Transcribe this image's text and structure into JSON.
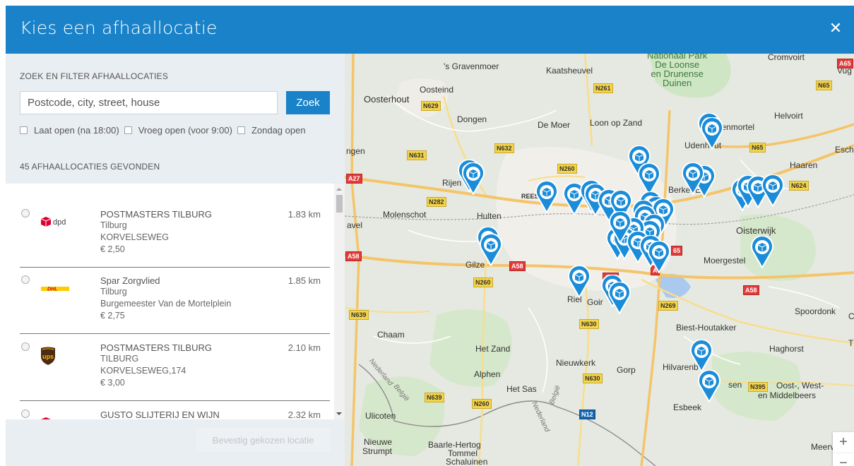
{
  "header": {
    "title": "Kies een afhaallocatie",
    "close_icon": "close-icon"
  },
  "filter": {
    "section_label": "ZOEK EN FILTER AFHAALLOCATIES",
    "search_placeholder": "Postcode, city, street, house",
    "search_button": "Zoek",
    "checkboxes": [
      "Laat open (na 18:00)",
      "Vroeg open (voor 9:00)",
      "Zondag open"
    ],
    "found_label": "45 AFHAALLOCATIES GEVONDEN"
  },
  "locations": [
    {
      "carrier": "dpd",
      "name": "POSTMASTERS TILBURG",
      "city": "Tilburg",
      "street": "KORVELSEWEG",
      "price": "€ 2,50",
      "distance": "1.83 km"
    },
    {
      "carrier": "dhl",
      "name": "Spar Zorgvlied",
      "city": "Tilburg",
      "street": "Burgemeester Van de Mortelplein",
      "price": "€ 2,75",
      "distance": "1.85 km"
    },
    {
      "carrier": "ups",
      "name": "POSTMASTERS TILBURG",
      "city": "TILBURG",
      "street": "KORVELSEWEG,174",
      "price": "€ 3,00",
      "distance": "2.10 km"
    },
    {
      "carrier": "dpd",
      "name": "GUSTO SLIJTERIJ EN WIJN",
      "city": "",
      "street": "",
      "price": "",
      "distance": "2.32 km"
    }
  ],
  "carrier_logos": {
    "dpd": "dpd",
    "dhl": "DHL",
    "ups": "ups"
  },
  "confirm_button": "Bevestig gekozen locatie",
  "map": {
    "places": [
      "'s Gravenmoer",
      "Kaatsheuvel",
      "Oosteind",
      "Oosterhout",
      "Dongen",
      "De Moer",
      "Loon op Zand",
      "Biezenmortel",
      "Helvoirt",
      "Cromvoirt",
      "Vug",
      "Udenhout",
      "Esch",
      "Haaren",
      "Rijen",
      "Berkel-En",
      "Molenschot",
      "Hulten",
      "avel",
      "Oisterwijk",
      "Gilze",
      "Moergestel",
      "Riel",
      "Goir",
      "Spoordonk",
      "Biest-Houtakker",
      "Chaam",
      "Het Zand",
      "Haghorst",
      "Nieuwkerk",
      "Gorp",
      "Hilvarenbe",
      "Oost-, West-",
      "en Middelbeers",
      "Alphen",
      "Het Sas",
      "Esbeek",
      "Ulicoten",
      "Nieuwe",
      "Strumpt",
      "Baarle-Hertog",
      "Tommel",
      "Schaluinen",
      "Meerv",
      "ngen",
      "T",
      "C",
      "REESHOF",
      "sen"
    ],
    "park": [
      "Nationaal Park",
      "De Loonse",
      "en Drunense",
      "Duinen"
    ],
    "roads_n": [
      "N261",
      "N629",
      "N65",
      "N632",
      "N631",
      "N260",
      "N282",
      "N624",
      "N65",
      "N269",
      "N639",
      "N630",
      "N630",
      "N639",
      "N260",
      "N260",
      "N395"
    ],
    "roads_a": [
      "A27",
      "A58",
      "A58",
      "A58",
      "A58",
      "65",
      "A65",
      "A"
    ],
    "roads_b": [
      "N12"
    ],
    "borders": [
      "Nederland",
      "België",
      "Nederland",
      "België"
    ],
    "zoom_in": "+",
    "zoom_out": "−"
  },
  "colors": {
    "header": "#1a82c8",
    "button": "#1a82c8",
    "pin": "#1a8cd8",
    "panel": "#e9eef2"
  }
}
